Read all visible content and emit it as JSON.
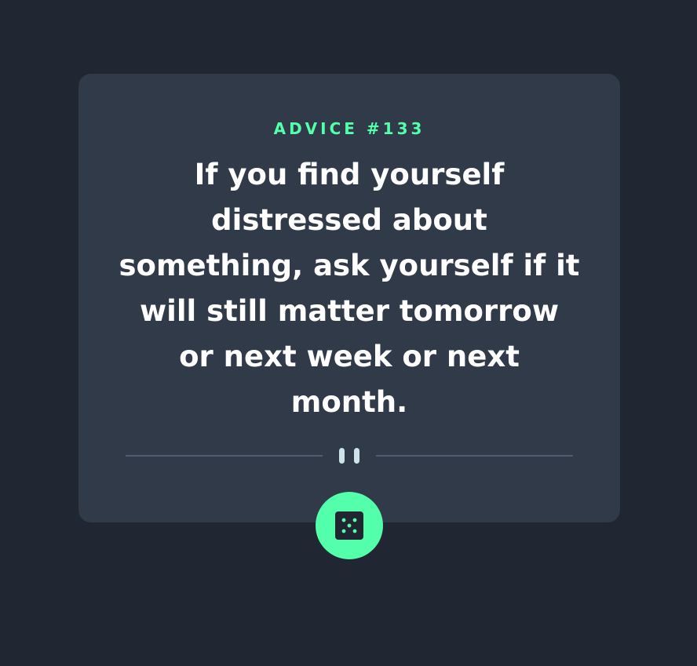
{
  "card": {
    "advice_label": "ADVICE #133",
    "quote": "If you find yourself distressed about something, ask yourself if it will still matter tomorrow or next week or next month."
  },
  "divider": {
    "icon": "pause-icon"
  },
  "dice_button": {
    "icon": "dice-icon"
  },
  "colors": {
    "background": "#202733",
    "card": "#313a48",
    "accent": "#53ffaa",
    "text": "#ffffff",
    "divider_line": "#4f5d74",
    "pause_icon": "#cee3e9"
  }
}
